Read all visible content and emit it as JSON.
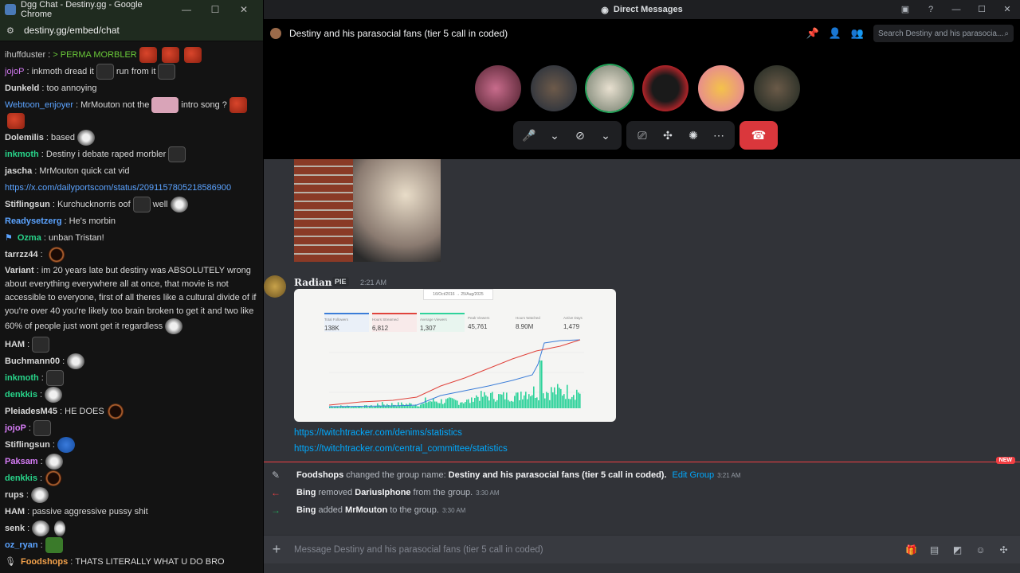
{
  "chrome": {
    "title": "Dgg Chat - Destiny.gg - Google Chrome",
    "url": "destiny.gg/embed/chat"
  },
  "chat": {
    "lines": [
      {
        "user": "ihuffduster",
        "user_color": "#c8c8c8",
        "text": "> PERMA MORBLER",
        "text_color": "#6ac939"
      },
      {
        "user": "jojoP",
        "user_color": "#d57cf5",
        "text": "inkmoth dread it",
        "text2": "run from it"
      },
      {
        "user": "Dunkeld",
        "user_color": "#e0e0e0",
        "text": "too annoying"
      },
      {
        "user": "Webtoon_enjoyer",
        "user_color": "#5ba3ff",
        "text": "MrMouton not the",
        "text2": "intro song ?"
      },
      {
        "user": "Dolemilis",
        "user_color": "#e0e0e0",
        "text": "based"
      },
      {
        "user": "inkmoth",
        "user_color": "#28d48a",
        "text": "Destiny i debate raped morbler"
      },
      {
        "user": "jascha",
        "user_color": "#e0e0e0",
        "text": "MrMouton quick cat vid"
      },
      {
        "link": "https://x.com/dailyportscom/status/2091157805218586900"
      },
      {
        "user": "Stiflingsun",
        "user_color": "#e0e0e0",
        "text": "Kurchucknorris oof",
        "text2": "well"
      },
      {
        "user": "Readysetzerg",
        "user_color": "#5ba3ff",
        "text": "He's morbin"
      },
      {
        "user": "Ozma",
        "user_color": "#28d48a",
        "text": "unban Tristan!"
      },
      {
        "user": "tarrzz44",
        "user_color": "#e0e0e0",
        "text": ""
      },
      {
        "user": "Variant",
        "user_color": "#e0e0e0",
        "text": "im 20 years late but destiny was ABSOLUTELY wrong about everything everywhere all at once, that movie is not accessible to everyone, first of all theres like a cultural divide of if you're over 40 you're likely too brain broken to get it and two like 60% of people just wont get it regardless"
      },
      {
        "user": "HAM",
        "user_color": "#e0e0e0",
        "text": ""
      },
      {
        "user": "Buchmann00",
        "user_color": "#e0e0e0",
        "text": ""
      },
      {
        "user": "inkmoth",
        "user_color": "#28d48a",
        "text": ""
      },
      {
        "user": "denkkis",
        "user_color": "#28d48a",
        "text": ""
      },
      {
        "user": "PleiadesM45",
        "user_color": "#e0e0e0",
        "text": "HE DOES"
      },
      {
        "user": "jojoP",
        "user_color": "#d57cf5",
        "text": ""
      },
      {
        "user": "Stiflingsun",
        "user_color": "#e0e0e0",
        "text": ""
      },
      {
        "user": "Paksam",
        "user_color": "#d57cf5",
        "text": ""
      },
      {
        "user": "denkkis",
        "user_color": "#28d48a",
        "text": ""
      },
      {
        "user": "rups",
        "user_color": "#e0e0e0",
        "text": ""
      },
      {
        "user": "HAM",
        "user_color": "#e0e0e0",
        "text": "passive aggressive pussy shit"
      },
      {
        "user": "senk",
        "user_color": "#e0e0e0",
        "text": ""
      },
      {
        "user": "oz_ryan",
        "user_color": "#5ba3ff",
        "text": ""
      },
      {
        "user": "Foodshops",
        "user_color": "#f2a14b",
        "text": "THATS LITERALLY WHAT U DO BRO"
      }
    ]
  },
  "discord": {
    "window_title": "Direct Messages",
    "group_title": "Destiny and his parasocial fans (tier 5 call in coded)",
    "search_placeholder": "Search Destiny and his parasocia...",
    "message": {
      "author": "Radiant",
      "tag": "PIE",
      "time": "2:21 AM",
      "links": [
        "https://twitchtracker.com/denims/statistics",
        "https://twitchtracker.com/central_committee/statistics"
      ]
    },
    "tracker": {
      "date_range": "16/Oct/2016 → 25/Aug/2025",
      "stats": [
        {
          "label": "Total Followers",
          "value": "138K"
        },
        {
          "label": "Hours Streamed",
          "value": "6,812"
        },
        {
          "label": "Average Viewers",
          "value": "1,307"
        },
        {
          "label": "Peak Viewers",
          "value": "45,761"
        },
        {
          "label": "Hours Watched",
          "value": "8.90M"
        },
        {
          "label": "Active Days",
          "value": "1,479"
        }
      ]
    },
    "new_badge": "NEW",
    "system": [
      {
        "actor": "Foodshops",
        "verb": "changed the group name:",
        "object": "Destiny and his parasocial fans (tier 5 call in coded).",
        "link": "Edit Group",
        "time": "3:21 AM"
      },
      {
        "actor": "Bing",
        "verb": "removed",
        "object": "DariusIphone",
        "suffix": "from the group.",
        "time": "3:30 AM"
      },
      {
        "actor": "Bing",
        "verb": "added",
        "object": "MrMouton",
        "suffix": "to the group.",
        "time": "3:30 AM"
      }
    ],
    "composer_placeholder": "Message Destiny and his parasocial fans (tier 5 call in coded)"
  }
}
